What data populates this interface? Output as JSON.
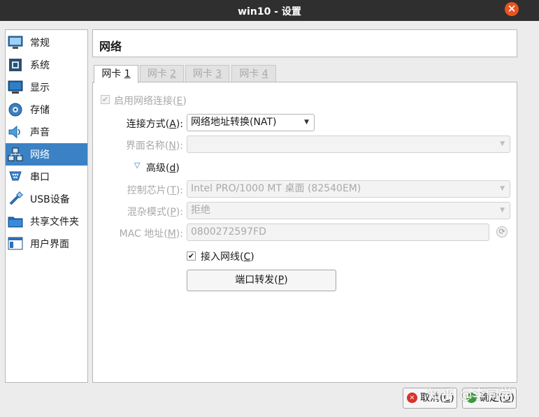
{
  "window": {
    "title": "win10 - 设置",
    "close_glyph": "×"
  },
  "sidebar": {
    "items": [
      {
        "label": "常规",
        "icon": "monitor-icon"
      },
      {
        "label": "系统",
        "icon": "chip-icon"
      },
      {
        "label": "显示",
        "icon": "display-icon"
      },
      {
        "label": "存储",
        "icon": "disk-icon"
      },
      {
        "label": "声音",
        "icon": "speaker-icon"
      },
      {
        "label": "网络",
        "icon": "network-icon",
        "selected": true
      },
      {
        "label": "串口",
        "icon": "serial-icon"
      },
      {
        "label": "USB设备",
        "icon": "usb-icon"
      },
      {
        "label": "共享文件夹",
        "icon": "folder-icon"
      },
      {
        "label": "用户界面",
        "icon": "ui-icon"
      }
    ]
  },
  "header": {
    "title": "网络"
  },
  "tabs": [
    {
      "text": "网卡 ",
      "mnemonic": "1",
      "active": true
    },
    {
      "text": "网卡 ",
      "mnemonic": "2"
    },
    {
      "text": "网卡 ",
      "mnemonic": "3"
    },
    {
      "text": "网卡 ",
      "mnemonic": "4"
    }
  ],
  "adapter": {
    "enable": {
      "text": "启用网络连接(",
      "mnemonic": "E",
      "close": ")",
      "checked": true,
      "disabled": true
    },
    "attached_to": {
      "text": "连接方式(",
      "mnemonic": "A",
      "close": "):",
      "value": "网络地址转换(NAT)"
    },
    "name": {
      "text": "界面名称(",
      "mnemonic": "N",
      "close": "):",
      "value": ""
    },
    "advanced": {
      "text": "高级(",
      "mnemonic": "d",
      "close": ")",
      "expanded": true
    },
    "adapter_type": {
      "text": "控制芯片(",
      "mnemonic": "T",
      "close": "):",
      "value": "Intel PRO/1000 MT 桌面 (82540EM)"
    },
    "promiscuous": {
      "text": "混杂模式(",
      "mnemonic": "P",
      "close": "):",
      "value": "拒绝"
    },
    "mac": {
      "text": "MAC 地址(",
      "mnemonic": "M",
      "close": "):",
      "value": "0800272597FD"
    },
    "cable": {
      "text": "接入网线(",
      "mnemonic": "C",
      "close": ")",
      "checked": true
    },
    "port_forwarding": {
      "text": "端口转发(",
      "mnemonic": "P",
      "close": ")"
    }
  },
  "footer": {
    "cancel": {
      "text": "取消(",
      "mnemonic": "C",
      "close": ")"
    },
    "ok": {
      "text": "确定(",
      "mnemonic": "O",
      "close": ")"
    }
  },
  "watermark": "知乎 @李同学",
  "colors": {
    "accent": "#3b82c4",
    "titlebar": "#2f2f2f",
    "close": "#e9541f"
  }
}
